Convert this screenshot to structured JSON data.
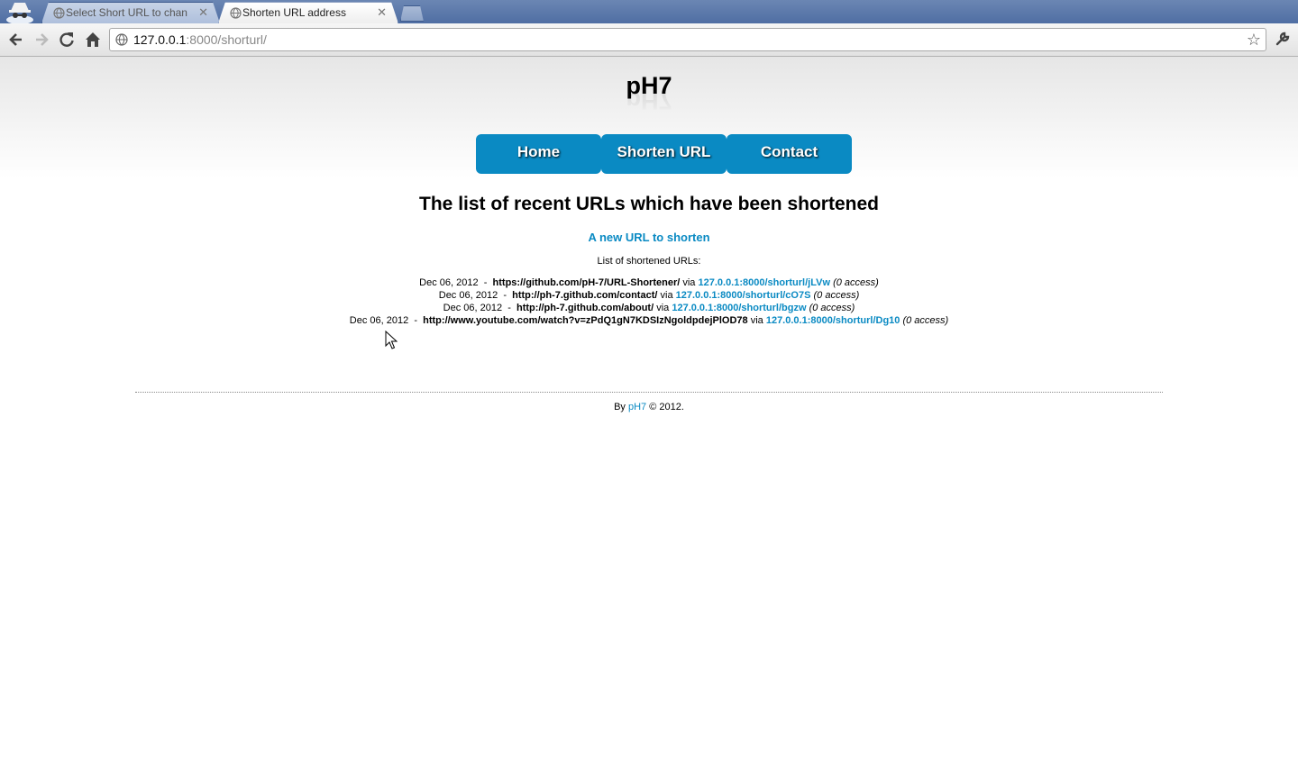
{
  "browser": {
    "tabs": [
      {
        "title": "Select Short URL to chan",
        "active": false
      },
      {
        "title": "Shorten URL address",
        "active": true
      }
    ],
    "address": {
      "host": "127.0.0.1",
      "rest": ":8000/shorturl/"
    }
  },
  "site": {
    "logo": "pH7",
    "nav": [
      "Home",
      "Shorten URL",
      "Contact"
    ],
    "accent_color": "#0a8ac3"
  },
  "main": {
    "heading": "The list of recent URLs which have been shortened",
    "new_url_link": "A new URL to shorten",
    "list_label": "List of shortened URLs:",
    "separator": "-",
    "via_label": "via",
    "rows": [
      {
        "date": "Dec 06, 2012",
        "url": "https://github.com/pH-7/URL-Shortener/",
        "short": "127.0.0.1:8000/shorturl/jLVw",
        "access": "(0 access)"
      },
      {
        "date": "Dec 06, 2012",
        "url": "http://ph-7.github.com/contact/",
        "short": "127.0.0.1:8000/shorturl/cO7S",
        "access": "(0 access)"
      },
      {
        "date": "Dec 06, 2012",
        "url": "http://ph-7.github.com/about/",
        "short": "127.0.0.1:8000/shorturl/bgzw",
        "access": "(0 access)"
      },
      {
        "date": "Dec 06, 2012",
        "url": "http://www.youtube.com/watch?v=zPdQ1gN7KDSIzNgoldpdejPlOD78",
        "short": "127.0.0.1:8000/shorturl/Dg10",
        "access": "(0 access)"
      }
    ]
  },
  "footer": {
    "by": "By",
    "author": "pH7",
    "copyright": "© 2012."
  }
}
